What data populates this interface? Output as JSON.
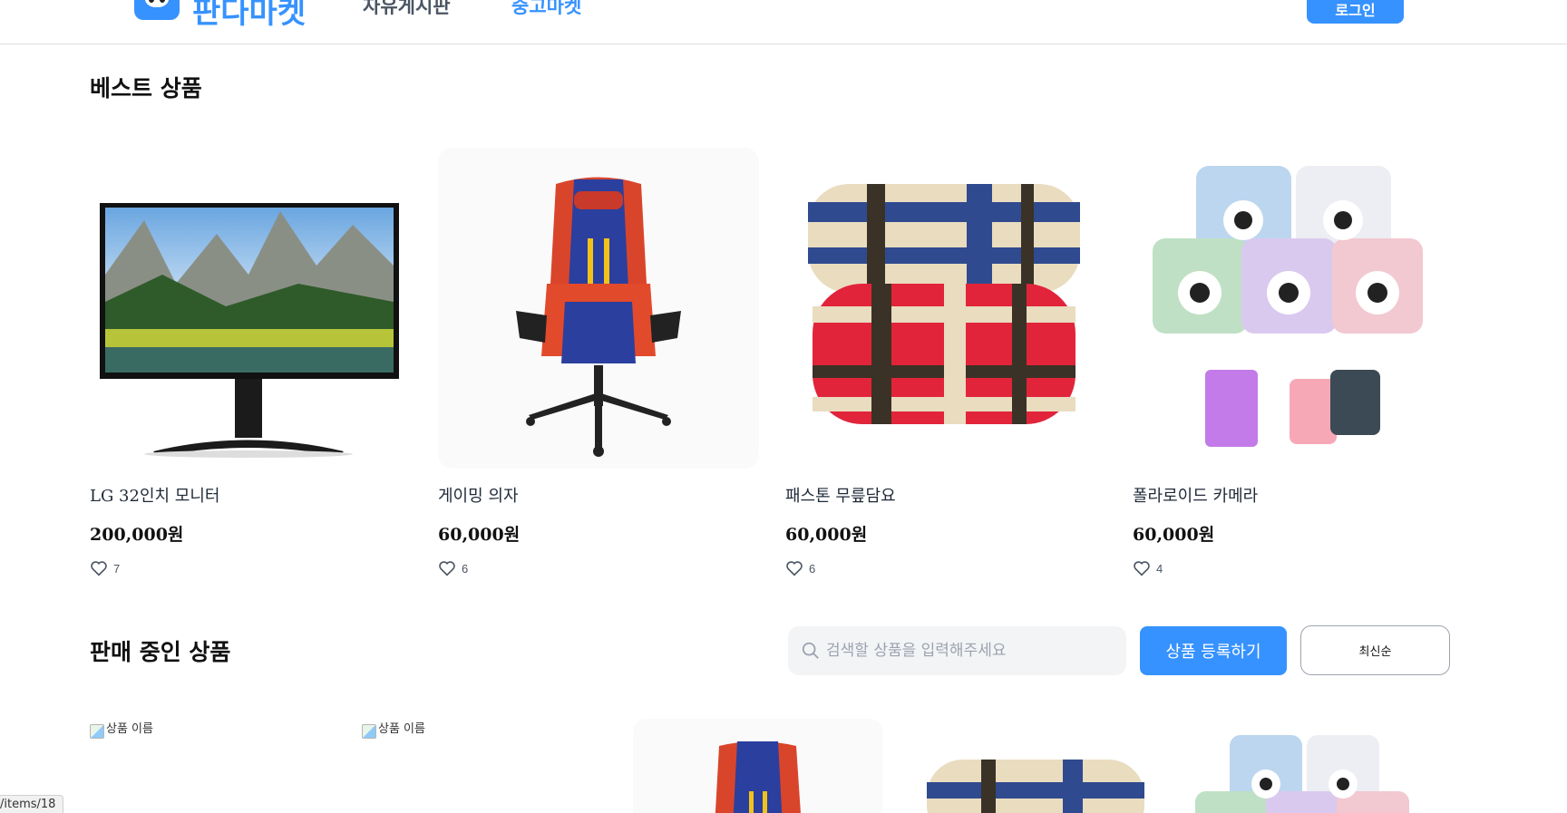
{
  "header": {
    "logo_text": "판다마켓",
    "nav": [
      {
        "label": "자유게시판",
        "active": false
      },
      {
        "label": "중고마켓",
        "active": true
      }
    ],
    "login_label": "로그인"
  },
  "best": {
    "title": "베스트 상품",
    "items": [
      {
        "name": "LG 32인치 모니터",
        "price": "200,000원",
        "likes": "7",
        "image": "monitor"
      },
      {
        "name": "게이밍 의자",
        "price": "60,000원",
        "likes": "6",
        "image": "gaming-chair"
      },
      {
        "name": "패스톤 무릎담요",
        "price": "60,000원",
        "likes": "6",
        "image": "blanket"
      },
      {
        "name": "폴라로이드 카메라",
        "price": "60,000원",
        "likes": "4",
        "image": "instant-camera"
      }
    ]
  },
  "sale": {
    "title": "판매 중인 상품",
    "search_placeholder": "검색할 상품을 입력해주세요",
    "register_label": "상품 등록하기",
    "sort_label": "최신순",
    "broken_alt": [
      "상품 이름",
      "상품 이름"
    ]
  },
  "status_url": "/items/18",
  "colors": {
    "accent": "#3692ff",
    "text": "#111111",
    "muted": "#4b5563",
    "input_bg": "#f3f4f6"
  }
}
